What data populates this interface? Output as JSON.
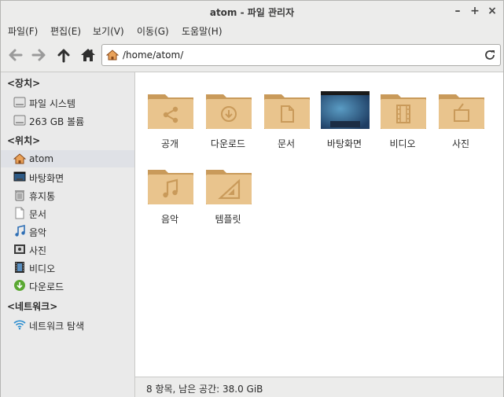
{
  "window": {
    "title": "atom - 파일 관리자"
  },
  "menu": [
    "파일(F)",
    "편집(E)",
    "보기(V)",
    "이동(G)",
    "도움말(H)"
  ],
  "path": {
    "value": "/home/atom/"
  },
  "sidebar": {
    "devices_title": "<장치>",
    "devices": [
      {
        "label": "파일 시스템",
        "icon": "drive-icon"
      },
      {
        "label": "263 GB 볼륨",
        "icon": "drive-icon"
      }
    ],
    "places_title": "<위치>",
    "places": [
      {
        "label": "atom",
        "icon": "home-icon",
        "selected": true
      },
      {
        "label": "바탕화면",
        "icon": "desktop-icon"
      },
      {
        "label": "휴지통",
        "icon": "trash-icon"
      },
      {
        "label": "문서",
        "icon": "document-icon"
      },
      {
        "label": "음악",
        "icon": "music-icon"
      },
      {
        "label": "사진",
        "icon": "picture-icon"
      },
      {
        "label": "비디오",
        "icon": "video-icon"
      },
      {
        "label": "다운로드",
        "icon": "download-icon"
      }
    ],
    "network_title": "<네트워크>",
    "network": [
      {
        "label": "네트워크 탐색",
        "icon": "wifi-icon"
      }
    ]
  },
  "folders": [
    {
      "label": "공개",
      "icon": "share-icon"
    },
    {
      "label": "다운로드",
      "icon": "download-icon"
    },
    {
      "label": "문서",
      "icon": "document-icon"
    },
    {
      "label": "바탕화면",
      "icon": "desktop-icon"
    },
    {
      "label": "비디오",
      "icon": "video-icon"
    },
    {
      "label": "사진",
      "icon": "picture-icon"
    },
    {
      "label": "음악",
      "icon": "music-icon"
    },
    {
      "label": "템플릿",
      "icon": "template-icon"
    }
  ],
  "status": "8 항목, 남은 공간: 38.0 GiB",
  "colors": {
    "folder": "#e9c48d",
    "folder_dark": "#c99a5a",
    "selection": "#dfe1e6"
  }
}
